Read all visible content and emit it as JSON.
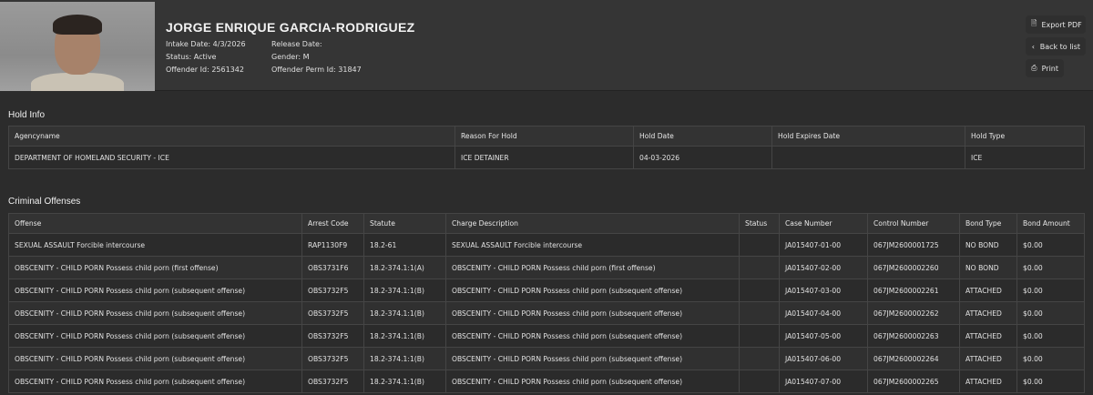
{
  "offender": {
    "name": "JORGE ENRIQUE GARCIA-RODRIGUEZ",
    "intake_date_label": "Intake Date:",
    "intake_date": "4/3/2026",
    "status_label": "Status:",
    "status": "Active",
    "offender_id_label": "Offender Id:",
    "offender_id": "2561342",
    "release_date_label": "Release Date:",
    "release_date": "",
    "gender_label": "Gender:",
    "gender": "M",
    "perm_id_label": "Offender Perm Id:",
    "perm_id": "31847"
  },
  "actions": {
    "export_pdf": "Export PDF",
    "back_to_list": "Back to list",
    "print": "Print"
  },
  "hold_info": {
    "title": "Hold Info",
    "columns": [
      "Agencyname",
      "Reason For Hold",
      "Hold Date",
      "Hold Expires Date",
      "Hold Type"
    ],
    "rows": [
      [
        "DEPARTMENT OF HOMELAND SECURITY - ICE",
        "ICE DETAINER",
        "04-03-2026",
        "",
        "ICE"
      ]
    ]
  },
  "criminal_offenses": {
    "title": "Criminal Offenses",
    "columns": [
      "Offense",
      "Arrest Code",
      "Statute",
      "Charge Description",
      "Status",
      "Case Number",
      "Control Number",
      "Bond Type",
      "Bond Amount"
    ],
    "rows": [
      [
        "SEXUAL ASSAULT Forcible intercourse",
        "RAP1130F9",
        "18.2-61",
        "SEXUAL ASSAULT Forcible intercourse",
        "",
        "JA015407-01-00",
        "067JM2600001725",
        "NO BOND",
        "$0.00"
      ],
      [
        "OBSCENITY - CHILD PORN Possess child porn (first offense)",
        "OBS3731F6",
        "18.2-374.1:1(A)",
        "OBSCENITY - CHILD PORN Possess child porn (first offense)",
        "",
        "JA015407-02-00",
        "067JM2600002260",
        "NO BOND",
        "$0.00"
      ],
      [
        "OBSCENITY - CHILD PORN Possess child porn (subsequent offense)",
        "OBS3732F5",
        "18.2-374.1:1(B)",
        "OBSCENITY - CHILD PORN Possess child porn (subsequent offense)",
        "",
        "JA015407-03-00",
        "067JM2600002261",
        "ATTACHED",
        "$0.00"
      ],
      [
        "OBSCENITY - CHILD PORN Possess child porn (subsequent offense)",
        "OBS3732F5",
        "18.2-374.1:1(B)",
        "OBSCENITY - CHILD PORN Possess child porn (subsequent offense)",
        "",
        "JA015407-04-00",
        "067JM2600002262",
        "ATTACHED",
        "$0.00"
      ],
      [
        "OBSCENITY - CHILD PORN Possess child porn (subsequent offense)",
        "OBS3732F5",
        "18.2-374.1:1(B)",
        "OBSCENITY - CHILD PORN Possess child porn (subsequent offense)",
        "",
        "JA015407-05-00",
        "067JM2600002263",
        "ATTACHED",
        "$0.00"
      ],
      [
        "OBSCENITY - CHILD PORN Possess child porn (subsequent offense)",
        "OBS3732F5",
        "18.2-374.1:1(B)",
        "OBSCENITY - CHILD PORN Possess child porn (subsequent offense)",
        "",
        "JA015407-06-00",
        "067JM2600002264",
        "ATTACHED",
        "$0.00"
      ],
      [
        "OBSCENITY - CHILD PORN Possess child porn (subsequent offense)",
        "OBS3732F5",
        "18.2-374.1:1(B)",
        "OBSCENITY - CHILD PORN Possess child porn (subsequent offense)",
        "",
        "JA015407-07-00",
        "067JM2600002265",
        "ATTACHED",
        "$0.00"
      ]
    ]
  }
}
